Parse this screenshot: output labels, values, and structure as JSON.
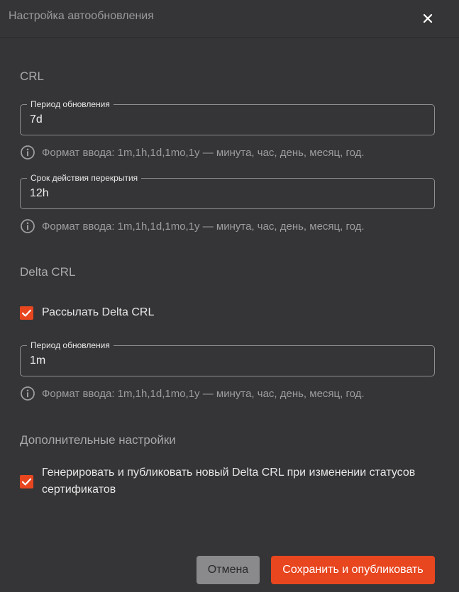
{
  "dialog": {
    "title": "Настройка автообновления",
    "close_icon": "close-icon"
  },
  "crl": {
    "section_title": "CRL",
    "update_period": {
      "label": "Период обновления",
      "value": "7d",
      "hint": "Формат ввода: 1m,1h,1d,1mo,1y — минута, час, день, месяц, год."
    },
    "overlap_period": {
      "label": "Срок действия перекрытия",
      "value": "12h",
      "hint": "Формат ввода: 1m,1h,1d,1mo,1y — минута, час, день, месяц, год."
    }
  },
  "delta_crl": {
    "section_title": "Delta CRL",
    "send_checkbox": {
      "label": "Рассылать Delta CRL",
      "checked": true
    },
    "update_period": {
      "label": "Период обновления",
      "value": "1m",
      "hint": "Формат ввода: 1m,1h,1d,1mo,1y — минута, час, день, месяц, год."
    }
  },
  "additional": {
    "section_title": "Дополнительные настройки",
    "generate_checkbox": {
      "label": "Генерировать и публиковать новый Delta CRL при изменении статусов сертификатов",
      "checked": true
    }
  },
  "footer": {
    "cancel_label": "Отмена",
    "save_label": "Сохранить и опубликовать"
  },
  "colors": {
    "background": "#353537",
    "accent": "#e8461f",
    "cancel_button": "#8a8a8c",
    "border": "#8e8e90",
    "muted_text": "#9d9d9f"
  },
  "icons": {
    "info": "info-icon",
    "check": "checkmark-icon"
  }
}
